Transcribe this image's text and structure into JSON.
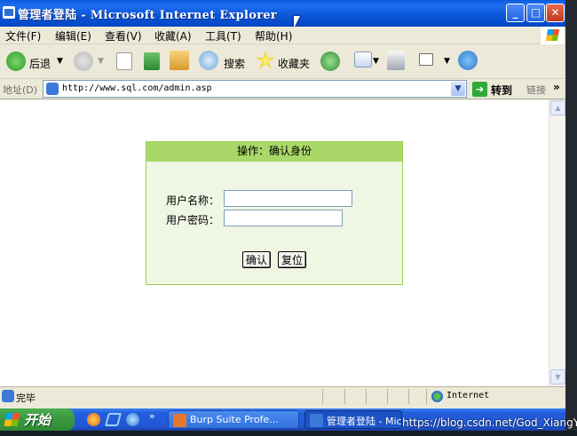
{
  "window": {
    "title": "管理者登陆 - Microsoft Internet Explorer",
    "minimize": "_",
    "maximize": "□",
    "close": "✕"
  },
  "menubar": {
    "items": [
      "文件(F)",
      "编辑(E)",
      "查看(V)",
      "收藏(A)",
      "工具(T)",
      "帮助(H)"
    ]
  },
  "toolbar": {
    "back_label": "后退",
    "search_label": "搜索",
    "favorites_label": "收藏夹"
  },
  "address": {
    "label": "地址(D)",
    "url": "http://www.sql.com/admin.asp",
    "go_label": "转到",
    "links_label": "链接",
    "links_chevron": "»"
  },
  "page": {
    "panel_title": "操作：确认身份",
    "username_label": "用户名称：",
    "username_value": "",
    "password_label": "用户密码：",
    "password_value": "",
    "confirm_label": "确认",
    "reset_label": "复位"
  },
  "statusbar": {
    "status_text": "完毕",
    "zone_text": "Internet"
  },
  "taskbar": {
    "start_label": "开始",
    "quicklaunch_more": "»",
    "tasks": [
      {
        "label": "Burp Suite Profe..."
      },
      {
        "label": "管理者登陆 - Mic..."
      }
    ]
  },
  "watermark": "https://blog.csdn.net/God_XiangYu",
  "colors": {
    "titlebar": "#0a55d8",
    "panel_header": "#a9d768",
    "panel_body": "#f0f6e4",
    "taskbar": "#245edc",
    "start_button": "#3c9c42"
  }
}
